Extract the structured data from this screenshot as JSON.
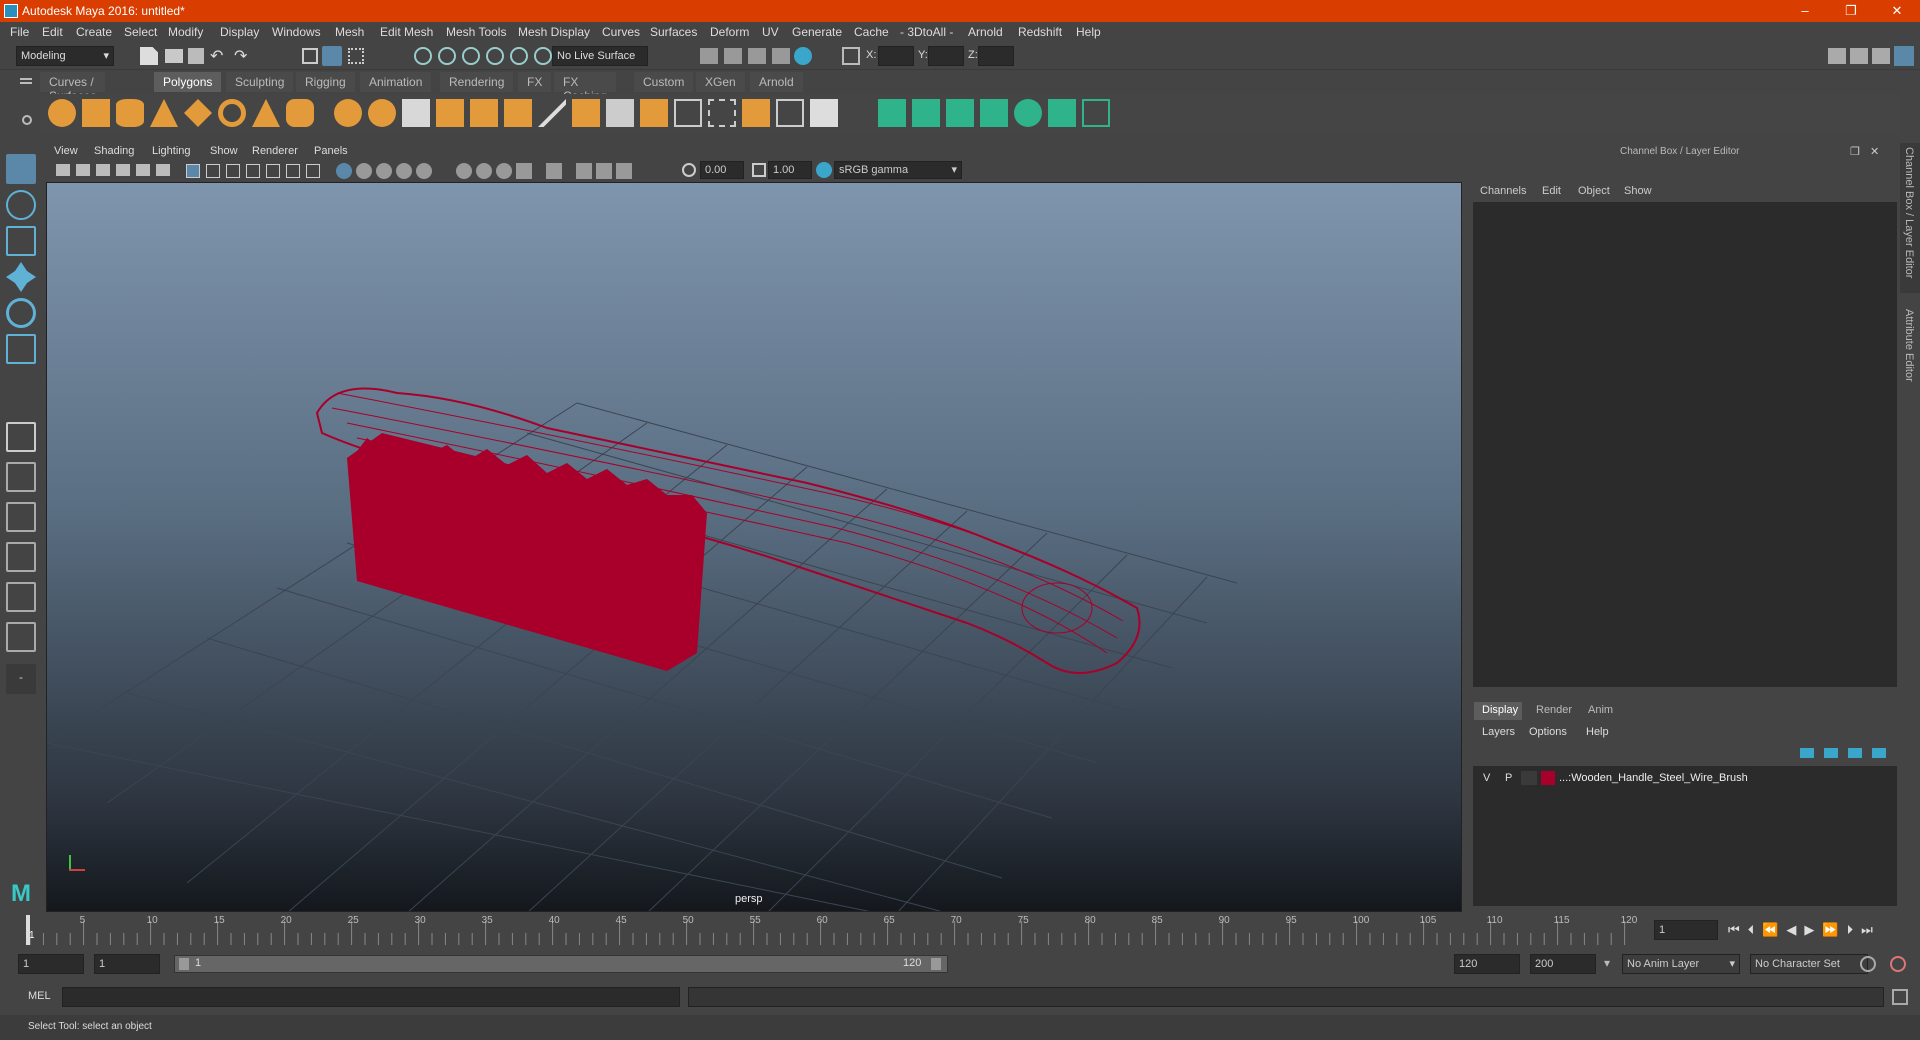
{
  "window": {
    "title": "Autodesk Maya 2016: untitled*",
    "min": "–",
    "max": "❐",
    "close": "✕"
  },
  "menu": [
    "File",
    "Edit",
    "Create",
    "Select",
    "Modify",
    "Display",
    "Windows",
    "Mesh",
    "Edit Mesh",
    "Mesh Tools",
    "Mesh Display",
    "Curves",
    "Surfaces",
    "Deform",
    "UV",
    "Generate",
    "Cache",
    "- 3DtoAll -",
    "Arnold",
    "Redshift",
    "Help"
  ],
  "status": {
    "mode": "Modeling",
    "live_surface": "No Live Surface",
    "x_label": "X:",
    "y_label": "Y:",
    "z_label": "Z:"
  },
  "shelf_tabs": [
    "Curves / Surfaces",
    "Polygons",
    "Sculpting",
    "Rigging",
    "Animation",
    "Rendering",
    "FX",
    "FX Caching",
    "Custom",
    "XGen",
    "Arnold"
  ],
  "shelf_active": "Polygons",
  "viewport": {
    "menus": [
      "View",
      "Shading",
      "Lighting",
      "Show",
      "Renderer",
      "Panels"
    ],
    "exposure": "0.00",
    "gamma": "1.00",
    "color_space": "sRGB gamma",
    "camera": "persp",
    "accent": "#a8002a"
  },
  "channel_box": {
    "title": "Channel Box / Layer Editor",
    "menus": [
      "Channels",
      "Edit",
      "Object",
      "Show"
    ],
    "side_tabs": [
      "Channel Box / Layer Editor",
      "Attribute Editor"
    ]
  },
  "layer_editor": {
    "tabs": [
      "Display",
      "Render",
      "Anim"
    ],
    "active_tab": "Display",
    "menus": [
      "Layers",
      "Options",
      "Help"
    ],
    "layer": {
      "v": "V",
      "p": "P",
      "name": "...:Wooden_Handle_Steel_Wire_Brush",
      "color": "#a8002a"
    }
  },
  "timeline": {
    "ticks": [
      "5",
      "10",
      "15",
      "20",
      "25",
      "30",
      "35",
      "40",
      "45",
      "50",
      "55",
      "60",
      "65",
      "70",
      "75",
      "80",
      "85",
      "90",
      "95",
      "100",
      "105",
      "110",
      "115",
      "120"
    ],
    "start_tick": "1",
    "current_frame": "1"
  },
  "range": {
    "start": "1",
    "playback_start": "1",
    "slider_left": "1",
    "slider_right": "120",
    "playback_end": "120",
    "end": "200",
    "anim_layer": "No Anim Layer",
    "char_set": "No Character Set"
  },
  "mel": {
    "label": "MEL"
  },
  "help": {
    "text": "Select Tool: select an object"
  }
}
